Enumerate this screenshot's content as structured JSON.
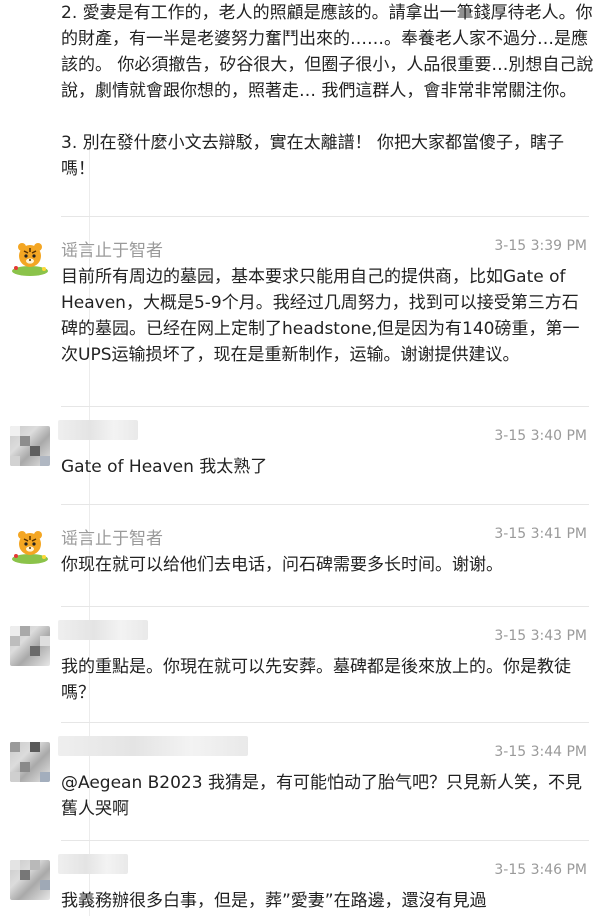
{
  "intro": {
    "para1": "2. 愛妻是有工作的，老人的照顧是應該的。請拿出一筆錢厚待老人。你的財產，有一半是老婆努力奮鬥出來的……。奉養老人家不過分…是應該的。 你必須撤告，矽谷很大，但圈子很小，人品很重要…別想自己說說，劇情就會跟你想的，照著走… 我們這群人，會非常非常關注你。",
    "para2": "3. 別在發什麼小文去辯駁，實在太離譜！ 你把大家都當傻子，瞎子嗎！"
  },
  "comments": [
    {
      "user": "谣言止于智者",
      "time": "3-15 3:39 PM",
      "text": "目前所有周边的墓园，基本要求只能用自己的提供商，比如Gate of Heaven，大概是5-9个月。我经过几周努力，找到可以接受第三方石碑的墓园。已经在网上定制了headstone,但是因为有140磅重，第一次UPS运输损坏了，现在是重新制作，运输。谢谢提供建议。",
      "avatar": "tiger-avatar"
    },
    {
      "user": "",
      "time": "3-15 3:40 PM",
      "text": "Gate of Heaven 我太熟了",
      "avatar": "blurred-avatar"
    },
    {
      "user": "谣言止于智者",
      "time": "3-15 3:41 PM",
      "text": "你现在就可以给他们去电话，问石碑需要多长时间。谢谢。",
      "avatar": "tiger-avatar"
    },
    {
      "user": "",
      "time": "3-15 3:43 PM",
      "text": "我的重點是。你現在就可以先安葬。墓碑都是後來放上的。你是教徒嗎？",
      "avatar": "blurred-avatar"
    },
    {
      "user": "",
      "time": "3-15 3:44 PM",
      "text": "@Aegean B2023 我猜是，有可能怕动了胎气吧？只見新人笑，不見舊人哭啊",
      "avatar": "blurred-avatar"
    },
    {
      "user": "",
      "time": "3-15 3:46 PM",
      "text": "我義務辦很多白事，但是，葬”愛妻”在路邊，還沒有見過",
      "avatar": "blurred-avatar"
    }
  ],
  "colors": {
    "text": "#222222",
    "meta": "#9a9a9a",
    "separator": "#e6e6e6"
  }
}
